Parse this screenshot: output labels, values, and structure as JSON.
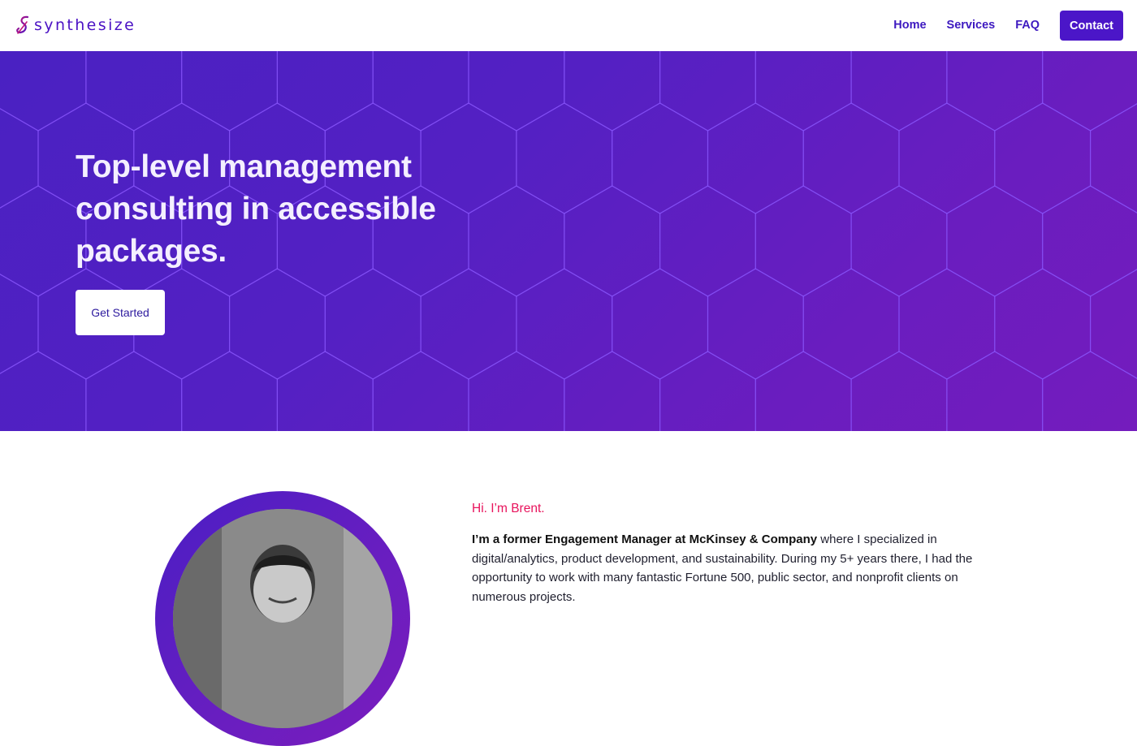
{
  "brand": {
    "name": "synthesize",
    "color": "#4b12c4"
  },
  "nav": {
    "links": [
      {
        "label": "Home"
      },
      {
        "label": "Services"
      },
      {
        "label": "FAQ"
      }
    ],
    "cta_label": "Contact"
  },
  "hero": {
    "title": "Top-level management consulting in accessible packages.",
    "button_label": "Get Started",
    "gradient": [
      "#4a21c2",
      "#741cbd"
    ]
  },
  "about": {
    "greeting": "Hi. I’m Brent.",
    "bio_bold": "I’m a former Engagement Manager at McKinsey & Company",
    "bio_rest": " where I specialized in digital/analytics, product development, and sustainability. During my 5+ years there, I had the opportunity to work with many fantastic Fortune 500, public sector, and nonprofit clients on numerous projects.",
    "photo_alt": "portrait-photo"
  },
  "colors": {
    "accent": "#4b16c8",
    "greeting": "#e8135c"
  }
}
